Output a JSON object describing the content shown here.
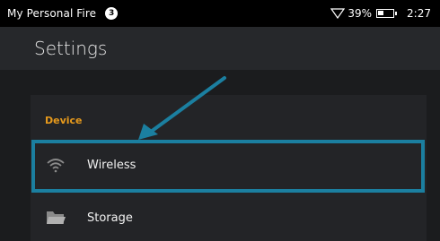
{
  "status_bar": {
    "title": "My Personal Fire",
    "notification_count": "3",
    "battery_percent": "39%",
    "time": "2:27"
  },
  "header": {
    "title": "Settings"
  },
  "section": {
    "label": "Device"
  },
  "items": [
    {
      "label": "Wireless",
      "icon": "wifi-icon"
    },
    {
      "label": "Storage",
      "icon": "folder-icon"
    }
  ],
  "colors": {
    "accent": "#e79a1c",
    "highlight": "#1b7fa0",
    "background": "#1b1c1e"
  }
}
